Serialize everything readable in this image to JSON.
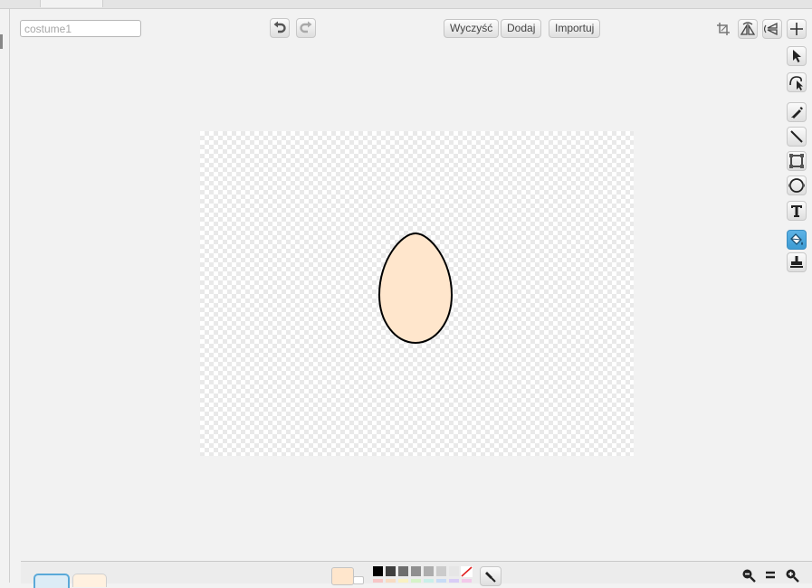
{
  "costume": {
    "name_value": "",
    "name_placeholder": "costume1"
  },
  "toolbar": {
    "clear_label": "Wyczyść",
    "add_label": "Dodaj",
    "import_label": "Importuj"
  },
  "colors": {
    "accent": "#4aa6dc",
    "canvas_checker": "#e9e9e9",
    "fill_color": "#ffe6cc",
    "stroke_color": "#000000"
  },
  "palette": [
    "#000000",
    "#3f3f3f",
    "#6e6e6e",
    "#8f8f8f",
    "#adadad",
    "#cbcbcb",
    "#e6e6e6",
    "#ffffff"
  ],
  "palette_lower": [
    "#f7c6c6",
    "#f8dcc2",
    "#f9f1c2",
    "#d6f3c8",
    "#c9efe9",
    "#c8dcf6",
    "#d9cdf6",
    "#f3c9ea"
  ],
  "icons": {
    "undo": "undo-icon",
    "redo": "redo-icon",
    "crop": "crop-icon",
    "flip_horizontal": "flip-horizontal-icon",
    "flip_vertical": "flip-vertical-icon",
    "set_center": "crosshair-icon",
    "select": "select-arrow-icon",
    "reshape": "reshape-icon",
    "brush": "pencil-icon",
    "line": "line-icon",
    "rectangle": "rectangle-icon",
    "ellipse": "ellipse-icon",
    "text": "text-icon",
    "fill": "paint-bucket-icon",
    "stamp": "stamp-icon",
    "zoom_out": "zoom-out-icon",
    "zoom_reset": "zoom-reset-icon",
    "zoom_in": "zoom-in-icon",
    "eyedropper": "eyedropper-icon"
  },
  "active_tool": "fill"
}
